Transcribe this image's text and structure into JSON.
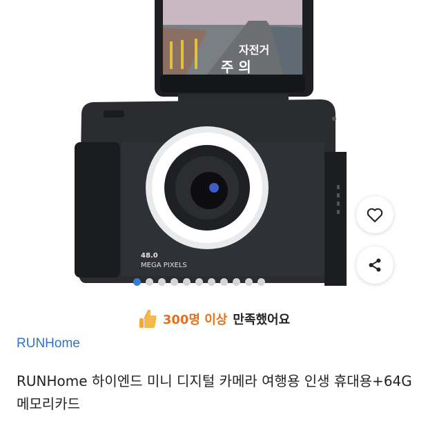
{
  "product": {
    "body_print_number": "48.0",
    "body_print_text": "MEGA PIXELS",
    "screen_road_text_top": "자전거",
    "screen_road_text_bottom": "주 의",
    "image_count": 11,
    "current_image_index": 1
  },
  "actions": {
    "wishlist_icon": "heart-outline-icon",
    "share_icon": "share-icon"
  },
  "satisfaction": {
    "icon": "thumbs-up-icon",
    "count_text": "300명 이상",
    "suffix_text": "만족했어요"
  },
  "brand": {
    "name": "RUNHome"
  },
  "title": "RUNHome 하이엔드 미니 디지털 카메라 여행용 인생 휴대용+64G메모리카드",
  "colors": {
    "brand_link": "#2b74c9",
    "accent_orange": "#e8701a",
    "dot_active": "#2f7fd9",
    "dot_inactive": "#d3d5d8"
  }
}
